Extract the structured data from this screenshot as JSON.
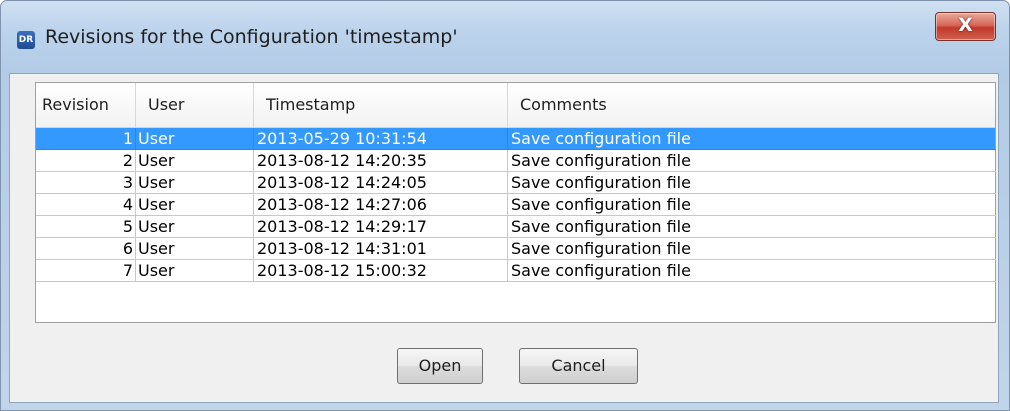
{
  "window": {
    "title": "Revisions for the Configuration 'timestamp'",
    "icon_text": "DR",
    "close_label": "X"
  },
  "table": {
    "columns": [
      "Revision",
      "User",
      "Timestamp",
      "Comments"
    ],
    "selected_row": 0,
    "rows": [
      {
        "revision": "1",
        "user": "User",
        "timestamp": "2013-05-29 10:31:54",
        "comment": "Save configuration file"
      },
      {
        "revision": "2",
        "user": "User",
        "timestamp": "2013-08-12 14:20:35",
        "comment": "Save configuration file"
      },
      {
        "revision": "3",
        "user": "User",
        "timestamp": "2013-08-12 14:24:05",
        "comment": "Save configuration file"
      },
      {
        "revision": "4",
        "user": "User",
        "timestamp": "2013-08-12 14:27:06",
        "comment": "Save configuration file"
      },
      {
        "revision": "5",
        "user": "User",
        "timestamp": "2013-08-12 14:29:17",
        "comment": "Save configuration file"
      },
      {
        "revision": "6",
        "user": "User",
        "timestamp": "2013-08-12 14:31:01",
        "comment": "Save configuration file"
      },
      {
        "revision": "7",
        "user": "User",
        "timestamp": "2013-08-12 15:00:32",
        "comment": "Save configuration file"
      }
    ]
  },
  "buttons": {
    "open_label": "Open",
    "cancel_label": "Cancel"
  },
  "colors": {
    "selection": "#3399ff",
    "close_button": "#c13a2a"
  },
  "icons": {
    "app": "dr-app-icon",
    "close": "close-icon"
  }
}
